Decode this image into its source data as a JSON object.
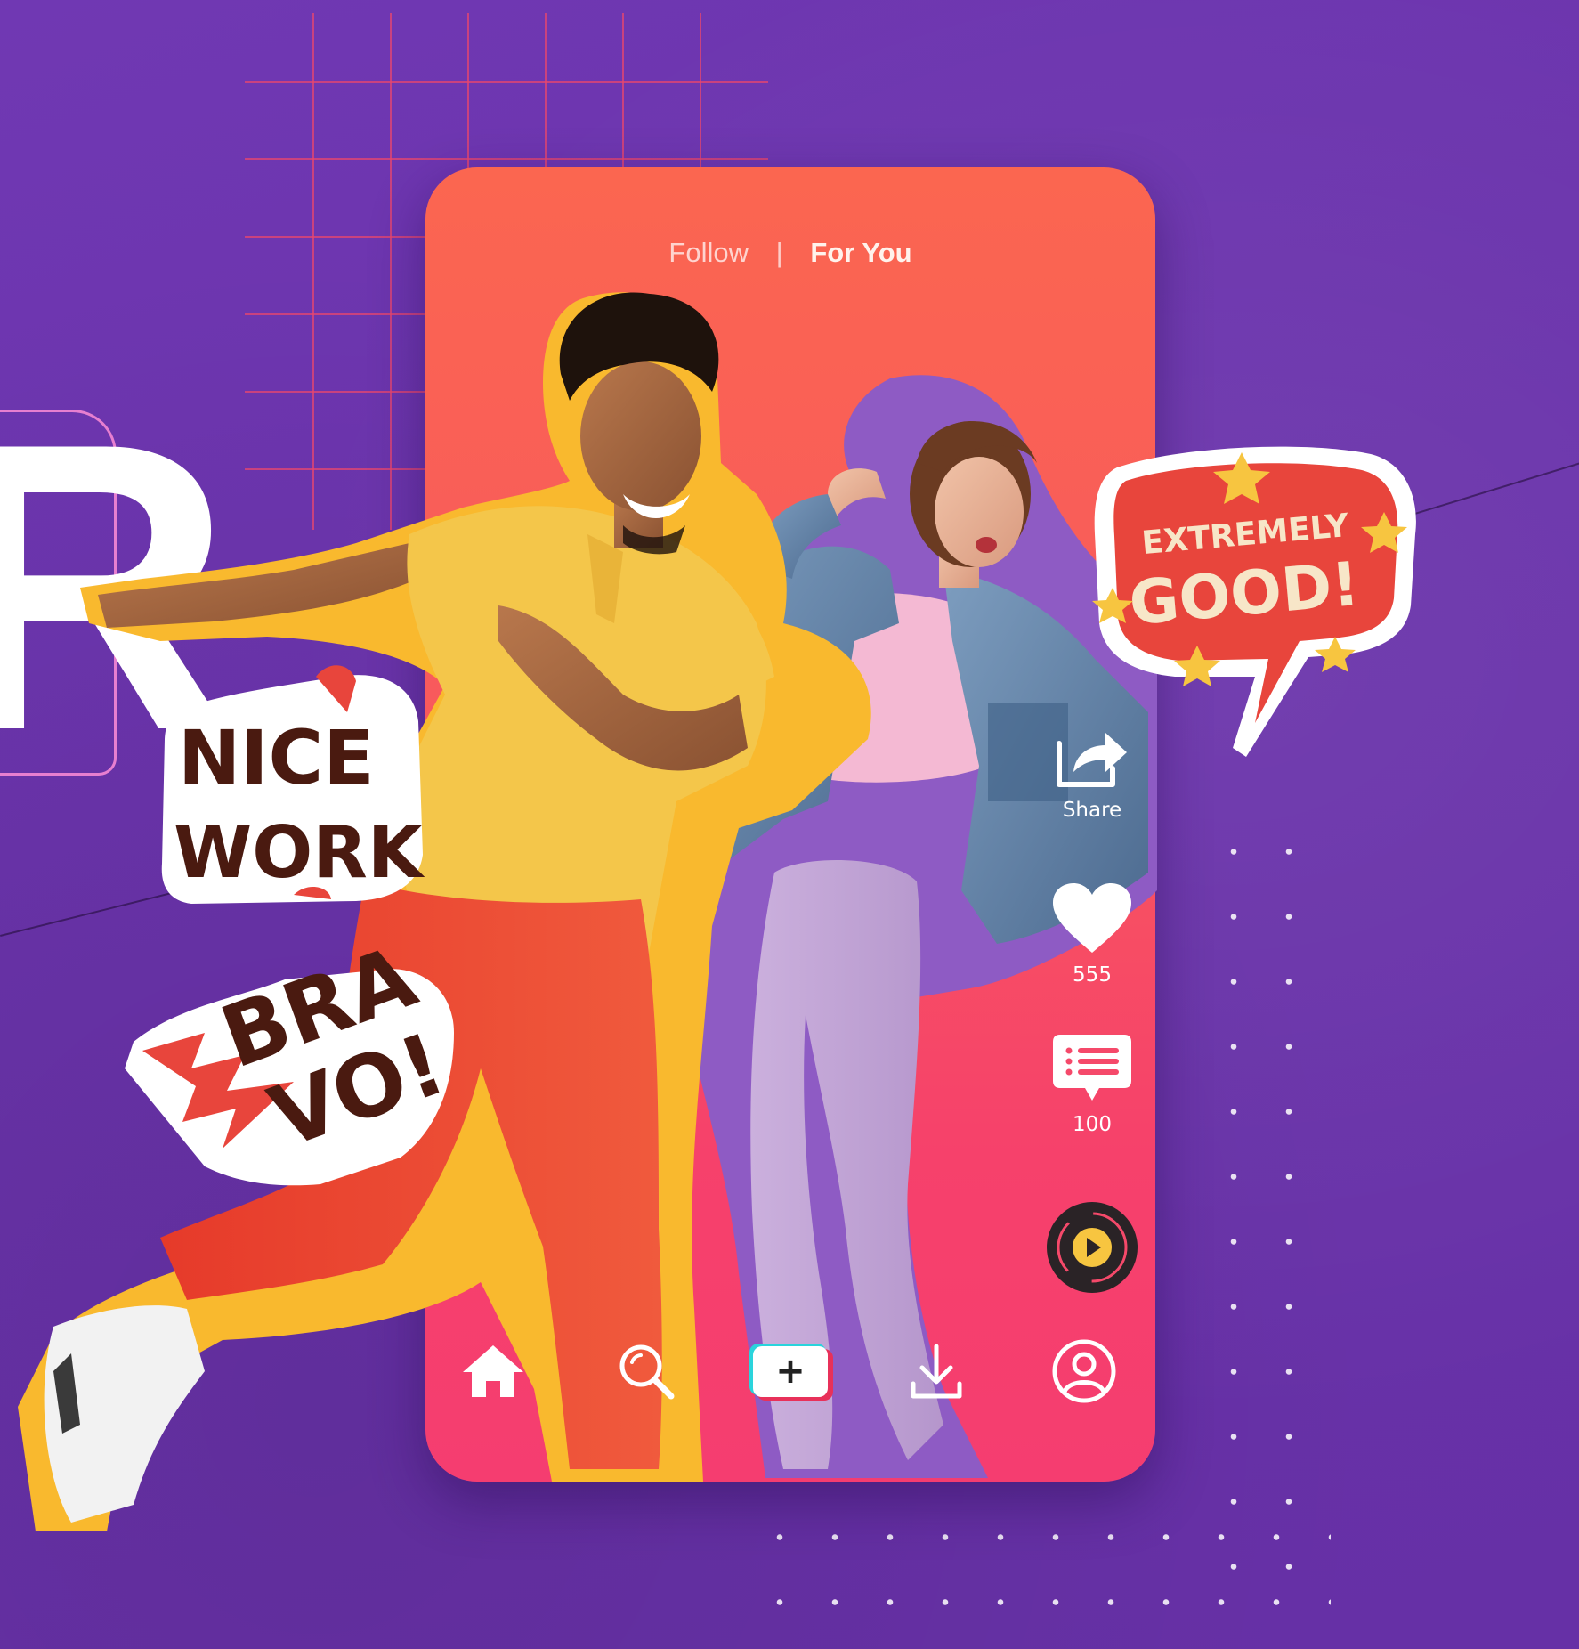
{
  "background": {
    "color": "#6b34ad",
    "grid_color": "#e8466e",
    "decor_letter": "R"
  },
  "feed": {
    "tabs": [
      {
        "label": "Follow",
        "active": false
      },
      {
        "label": "For You",
        "active": true
      }
    ],
    "separator": "|"
  },
  "actions": {
    "share": {
      "label": "Share",
      "icon": "share-icon"
    },
    "like": {
      "count": "555",
      "icon": "heart-icon"
    },
    "comment": {
      "count": "100",
      "icon": "comment-icon"
    },
    "music": {
      "icon": "music-disc-icon"
    }
  },
  "bottom_nav": [
    {
      "name": "home",
      "icon": "home-icon"
    },
    {
      "name": "search",
      "icon": "search-icon"
    },
    {
      "name": "create",
      "icon": "plus-icon",
      "glyph": "+"
    },
    {
      "name": "download",
      "icon": "download-icon"
    },
    {
      "name": "profile",
      "icon": "profile-icon"
    }
  ],
  "stickers": {
    "extremely_good": {
      "line1": "EXTREMELY",
      "line2": "GOOD!"
    },
    "nice_work": {
      "line1": "NICE",
      "line2": "WORK"
    },
    "bravo": {
      "line1": "BRA",
      "line2": "VO!"
    }
  },
  "colors": {
    "phone_top": "#fb6650",
    "phone_bottom": "#f53d70",
    "outline_yellow": "#f9b92e",
    "outline_purple": "#8e5bc4",
    "sticker_red": "#e8453c",
    "sticker_brown": "#4a1a10"
  }
}
